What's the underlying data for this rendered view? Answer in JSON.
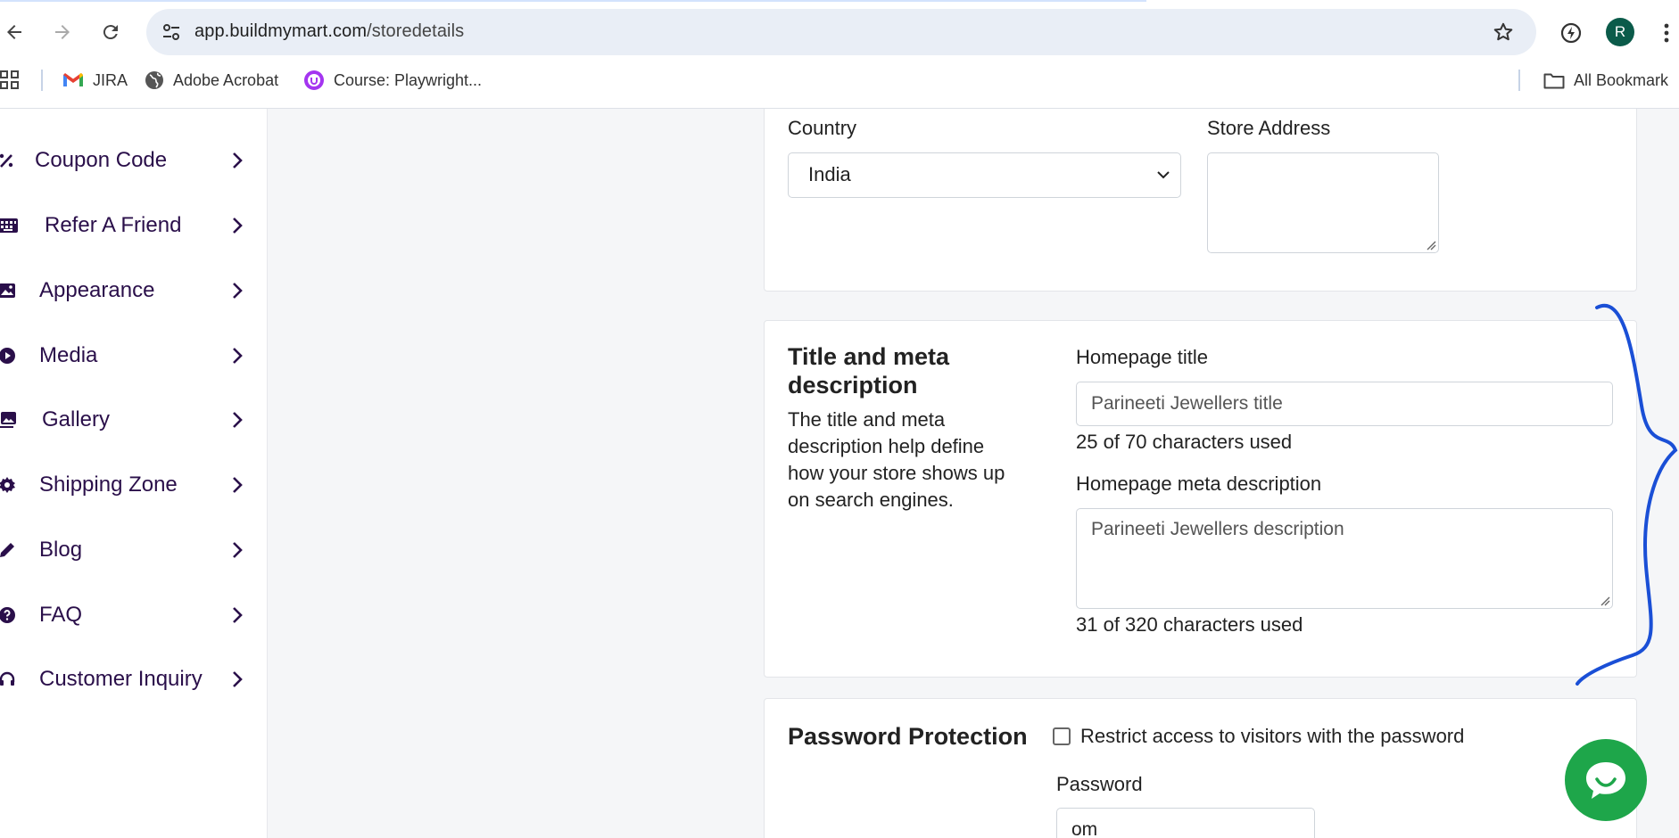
{
  "browser": {
    "url_host": "app.buildmymart.com",
    "url_path": "/storedetails",
    "profile_initial": "R",
    "bookmarks": [
      {
        "label": "JIRA",
        "icon": "gmail-icon"
      },
      {
        "label": "Adobe Acrobat",
        "icon": "globe-icon"
      },
      {
        "label": "Course: Playwright...",
        "icon": "course-icon"
      }
    ],
    "all_bookmarks_label": "All Bookmark"
  },
  "sidebar": {
    "items": [
      {
        "label": "Coupon Code",
        "icon": "coupon-icon"
      },
      {
        "label": "Refer A Friend",
        "icon": "keyboard-icon"
      },
      {
        "label": "Appearance",
        "icon": "image-icon"
      },
      {
        "label": "Media",
        "icon": "play-icon"
      },
      {
        "label": "Gallery",
        "icon": "gallery-icon"
      },
      {
        "label": "Shipping Zone",
        "icon": "gear-icon"
      },
      {
        "label": "Blog",
        "icon": "pencil-icon"
      },
      {
        "label": "FAQ",
        "icon": "question-icon"
      },
      {
        "label": "Customer Inquiry",
        "icon": "headset-icon"
      }
    ]
  },
  "address_card": {
    "country_label": "Country",
    "country_value": "India",
    "store_address_label": "Store Address",
    "store_address_value": ""
  },
  "seo_card": {
    "title": "Title and meta description",
    "title_line1": "Title and meta",
    "title_line2": "description",
    "help_lines": [
      "The title and meta",
      "description help define",
      "how your store shows up",
      "on search engines."
    ],
    "homepage_title_label": "Homepage title",
    "homepage_title_value": "Parineeti Jewellers title",
    "homepage_title_counter": "25 of 70 characters used",
    "meta_label": "Homepage meta description",
    "meta_value": "Parineeti Jewellers description",
    "meta_counter": "31 of 320 characters used"
  },
  "password_card": {
    "title": "Password Protection",
    "restrict_label": "Restrict access to visitors with the password",
    "restrict_checked": false,
    "password_label": "Password",
    "password_value": "om"
  },
  "colors": {
    "accent_purple": "#2a0f4a",
    "chat_green": "#1ea64a",
    "annotation_blue": "#1a4fd6"
  }
}
